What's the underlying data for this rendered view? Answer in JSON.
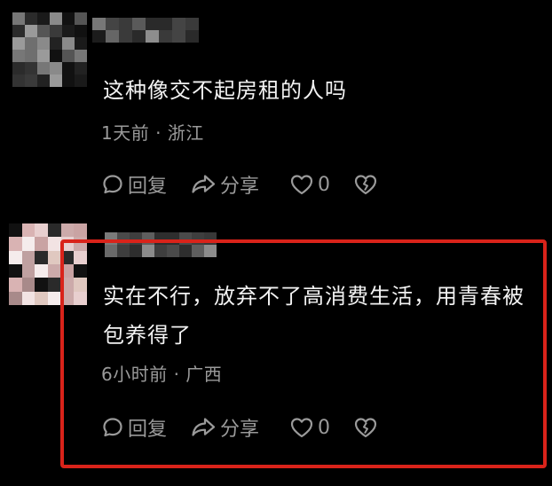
{
  "colors": {
    "background": "#000000",
    "text": "#f2f2f2",
    "meta": "#9a9a9a",
    "highlight_border": "#d9231a"
  },
  "comments": [
    {
      "text": "这种像交不起房租的人吗",
      "meta": "1天前 · 浙江",
      "actions": {
        "reply": "回复",
        "share": "分享",
        "like_count": "0"
      }
    },
    {
      "text": "实在不行，放弃不了高消费生活，用青春被\n包养得了",
      "meta": "6小时前 · 广西",
      "actions": {
        "reply": "回复",
        "share": "分享",
        "like_count": "0"
      }
    }
  ],
  "icons": [
    "reply-icon",
    "share-icon",
    "heart-icon",
    "dislike-heart-icon"
  ]
}
